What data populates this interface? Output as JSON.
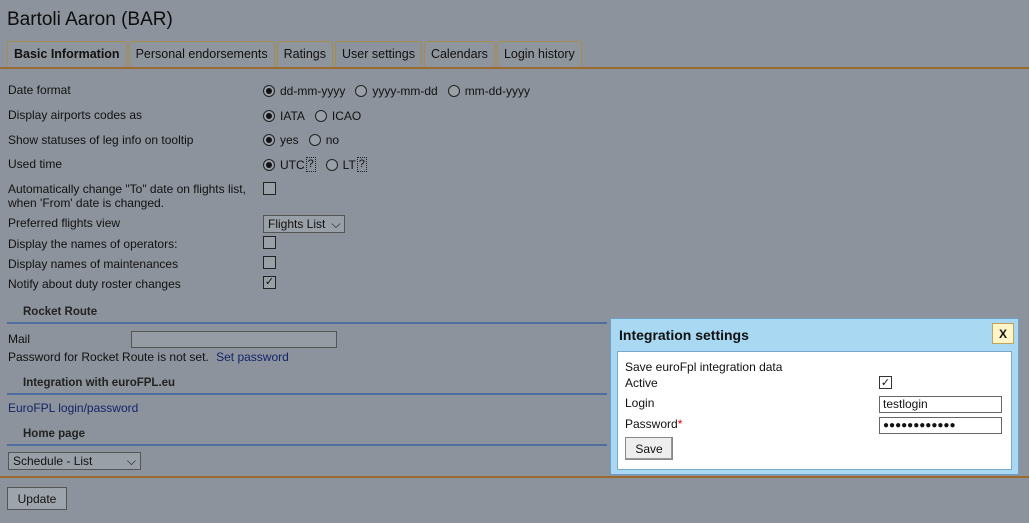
{
  "title": "Bartoli Aaron (BAR)",
  "tabs": [
    "Basic Information",
    "Personal endorsements",
    "Ratings",
    "User settings",
    "Calendars",
    "Login history"
  ],
  "settings": {
    "date_format": {
      "label": "Date format",
      "options": [
        "dd-mm-yyyy",
        "yyyy-mm-dd",
        "mm-dd-yyyy"
      ],
      "selected": "dd-mm-yyyy"
    },
    "airport_codes": {
      "label": "Display airports codes as",
      "options": [
        "IATA",
        "ICAO"
      ],
      "selected": "IATA"
    },
    "leg_statuses": {
      "label": "Show statuses of leg info on tooltip",
      "options": [
        "yes",
        "no"
      ],
      "selected": "yes"
    },
    "used_time": {
      "label": "Used time",
      "options": [
        "UTC",
        "LT"
      ],
      "selected": "UTC",
      "help_glyph": "?"
    },
    "auto_change_to": {
      "label_line1": "Automatically change \"To\" date on flights list,",
      "label_line2": "when 'From' date is changed.",
      "checked": false
    },
    "preferred_view": {
      "label": "Preferred flights view",
      "value": "Flights List"
    },
    "operator_names": {
      "label": "Display the names of operators:",
      "checked": false
    },
    "maintenance_names": {
      "label": "Display names of maintenances",
      "checked": false
    },
    "duty_roster": {
      "label": "Notify about duty roster changes",
      "checked": true
    }
  },
  "rocket_route": {
    "heading": "Rocket Route",
    "mail_label": "Mail",
    "mail_value": "",
    "password_note": "Password for Rocket Route is not set.",
    "set_password_link": "Set password"
  },
  "eurofpl": {
    "heading": "Integration with euroFPL.eu",
    "link": "EuroFPL login/password"
  },
  "home_page": {
    "heading": "Home page",
    "value": "Schedule - List"
  },
  "update_button": "Update",
  "dialog": {
    "title": "Integration settings",
    "close": "X",
    "subtitle": "Save euroFpl integration data",
    "active_label": "Active",
    "active_checked": true,
    "login_label": "Login",
    "login_value": "testlogin",
    "password_label": "Password",
    "password_required": "*",
    "password_masked": "●●●●●●●●●●●●",
    "save_button": "Save"
  }
}
